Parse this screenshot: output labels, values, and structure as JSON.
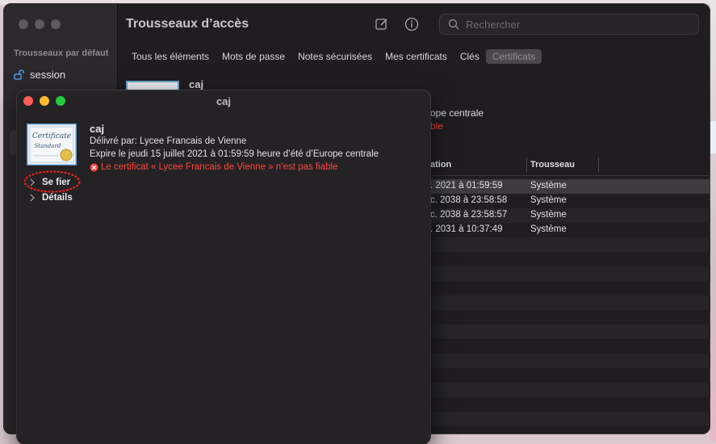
{
  "main_window": {
    "title": "Trousseaux d’accès",
    "search_placeholder": "Rechercher",
    "sidebar": {
      "heading": "Trousseaux par défaut",
      "items": [
        {
          "label": "session",
          "icon": "lock-icon"
        }
      ]
    },
    "tabs": [
      {
        "label": "Tous les éléments",
        "active": false
      },
      {
        "label": "Mots de passe",
        "active": false
      },
      {
        "label": "Notes sécurisées",
        "active": false
      },
      {
        "label": "Mes certificats",
        "active": false
      },
      {
        "label": "Clés",
        "active": false
      },
      {
        "label": "Certificats",
        "active": true
      }
    ],
    "detail_bg": {
      "title": "caj",
      "line1": "ope centrale",
      "line2": "ble"
    },
    "table": {
      "columns": [
        "ation",
        "Trousseau"
      ],
      "rows": [
        {
          "expiry": ". 2021 à 01:59:59",
          "keychain": "Système"
        },
        {
          "expiry": "c. 2038 à 23:58:58",
          "keychain": "Système"
        },
        {
          "expiry": "c. 2038 à 23:58:57",
          "keychain": "Système"
        },
        {
          "expiry": ". 2031 à 10:37:49",
          "keychain": "Système"
        }
      ]
    }
  },
  "dialog": {
    "title": "caj",
    "cert_name": "caj",
    "issuer": "Délivré par: Lycee Francais de Vienne",
    "expiry": "Expire le jeudi 15 juillet 2021 à 01:59:59 heure d’été d’Europe centrale",
    "warning": "Le certificat « Lycee Francais de Vienne » n’est pas fiable",
    "disclosures": [
      {
        "label": "Se fier",
        "highlighted": true
      },
      {
        "label": "Détails",
        "highlighted": false
      }
    ],
    "cert_image": {
      "line1": "Certificate",
      "line2": "Standard"
    }
  },
  "colors": {
    "warning_red": "#ff453a",
    "close": "#ff5f57",
    "minimize": "#febc2e",
    "zoom": "#28c840",
    "highlight_ring": "#e2231a"
  }
}
